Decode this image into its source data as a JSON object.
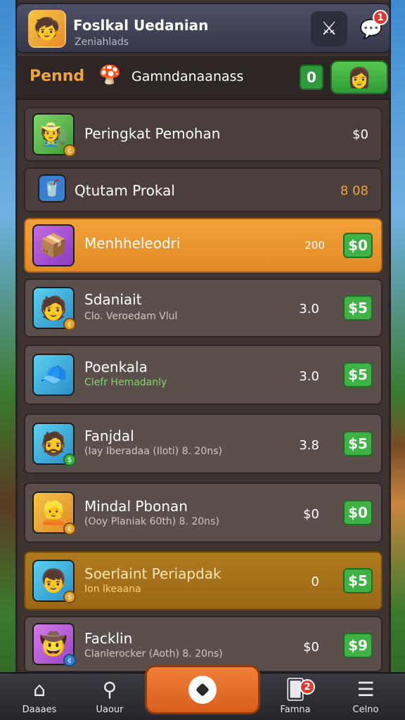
{
  "header": {
    "title": "Foslkal Uedanian",
    "subtitle": "Zeniahlads",
    "avatar_icon": "player-avatar",
    "close_icon": "crossed-swords-icon",
    "chat_badge": "1"
  },
  "tabs": {
    "primary_label": "Pennd",
    "secondary_label": "Gamndanaanass",
    "counter": "0",
    "profile_icon": "female-avatar"
  },
  "rows": [
    {
      "title": "Peringkat Pemohan",
      "subtitle": "",
      "amount": "$0",
      "button": "",
      "style": "dark"
    },
    {
      "title": "Qtutam Prokal",
      "subtitle": "",
      "amount": "8 08",
      "button": "",
      "style": "dark"
    },
    {
      "title": "Menhheleodri",
      "subtitle": "",
      "amount": "200",
      "button": "$0",
      "style": "orange"
    },
    {
      "title": "Sdaniait",
      "subtitle": "Clo. Veroedam Vlul",
      "amount": "3.0",
      "button": "$5",
      "style": "light"
    },
    {
      "title": "Poenkala",
      "subtitle": "Clefr Hemadanly",
      "amount": "3.0",
      "button": "$5",
      "style": "light"
    },
    {
      "title": "Fanjdal",
      "subtitle": "(Iay Iberadaa (Iloti) 8. 20ns)",
      "amount": "3.8",
      "button": "$5",
      "style": "light"
    },
    {
      "title": "Mindal Pbonan",
      "subtitle": "(Ooy Planiak 60th) 8. 20ns)",
      "amount": "$0",
      "button": "$0",
      "style": "light"
    },
    {
      "title": "Soerlaint Periapdak",
      "subtitle": "Ion lkeaana",
      "amount": "0",
      "button": "$5",
      "style": "gold"
    },
    {
      "title": "Facklin",
      "subtitle": "Clanlerocker (Aoth) 8. 20ns)",
      "amount": "$0",
      "button": "$9",
      "style": "light"
    }
  ],
  "bottom_nav": {
    "items": [
      {
        "label": "Daaaes",
        "icon": "home-icon"
      },
      {
        "label": "Uaour",
        "icon": "search-icon"
      },
      {
        "label": "Famna",
        "icon": "cards-icon",
        "badge": "2"
      },
      {
        "label": "Celno",
        "icon": "menu-icon"
      }
    ]
  }
}
